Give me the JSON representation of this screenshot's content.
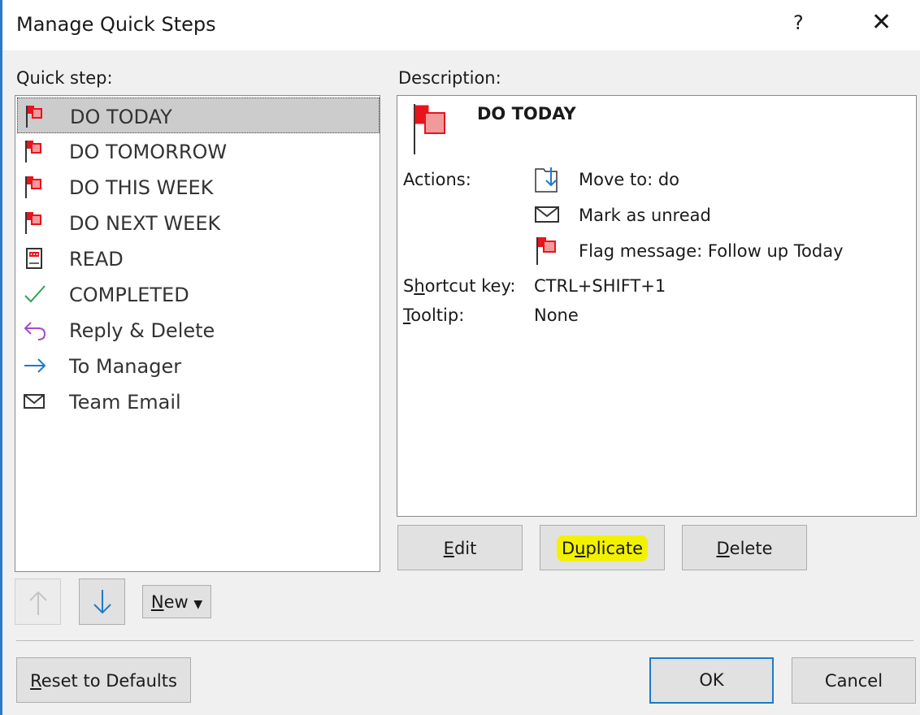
{
  "dialog": {
    "title": "Manage Quick Steps",
    "help_symbol": "?",
    "close_symbol": "✕"
  },
  "quick_steps": {
    "label": "Quick step:",
    "items": [
      {
        "label": "DO TODAY",
        "icon": "red-flag-icon",
        "selected": true
      },
      {
        "label": "DO TOMORROW",
        "icon": "red-flag-icon"
      },
      {
        "label": "DO THIS WEEK",
        "icon": "red-flag-icon"
      },
      {
        "label": "DO NEXT WEEK",
        "icon": "red-flag-icon"
      },
      {
        "label": "READ",
        "icon": "reading-icon"
      },
      {
        "label": "COMPLETED",
        "icon": "checkmark-icon"
      },
      {
        "label": "Reply & Delete",
        "icon": "reply-arrow-icon"
      },
      {
        "label": "To Manager",
        "icon": "right-arrow-icon"
      },
      {
        "label": "Team Email",
        "icon": "envelope-icon"
      }
    ]
  },
  "description": {
    "label": "Description:",
    "name": "DO TODAY",
    "actions_label": "Actions:",
    "actions": [
      {
        "icon": "move-to-folder-icon",
        "text": "Move to: do"
      },
      {
        "icon": "envelope-icon",
        "text": "Mark as unread"
      },
      {
        "icon": "red-flag-icon",
        "text": "Flag message: Follow up Today"
      }
    ],
    "shortcut_label_pre": "S",
    "shortcut_label_key": "h",
    "shortcut_label_post": "ortcut key:",
    "shortcut_value": "CTRL+SHIFT+1",
    "tooltip_label_key": "T",
    "tooltip_label_post": "ooltip:",
    "tooltip_value": "None"
  },
  "buttons": {
    "edit_key": "E",
    "edit_rest": "dit",
    "duplicate_pre": "D",
    "duplicate_key": "u",
    "duplicate_post": "plicate",
    "delete_key": "D",
    "delete_rest": "elete",
    "new_key": "N",
    "new_rest": "ew",
    "new_caret": "▼",
    "reset_key": "R",
    "reset_rest": "eset to Defaults",
    "ok": "OK",
    "cancel": "Cancel"
  },
  "colors": {
    "flag_red": "#e8141c",
    "flag_fill": "#f29a9a",
    "check_green": "#2ea44f",
    "reply_purple": "#a64ac9",
    "arrow_blue": "#1e7ac9",
    "highlight_yellow": "#f2f200",
    "ok_border": "#1e7ac9"
  }
}
